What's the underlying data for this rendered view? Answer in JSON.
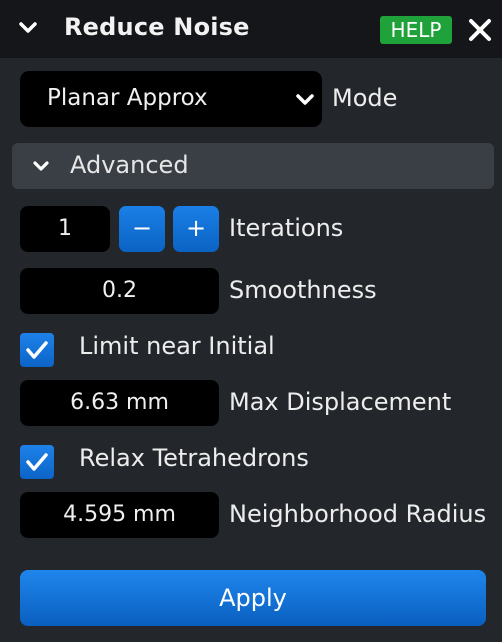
{
  "header": {
    "title": "Reduce Noise",
    "help_label": "HELP",
    "collapse_icon": "chevron-down-icon",
    "close_icon": "close-icon",
    "help_color": "#1fa23a"
  },
  "mode": {
    "selected": "Planar Approx",
    "label": "Mode"
  },
  "advanced": {
    "label": "Advanced",
    "expanded": true
  },
  "iterations": {
    "value": "1",
    "minus_label": "−",
    "plus_label": "+",
    "label": "Iterations"
  },
  "smoothness": {
    "value": "0.2",
    "label": "Smoothness"
  },
  "limit_near_initial": {
    "checked": true,
    "label": "Limit near Initial"
  },
  "max_displacement": {
    "value": "6.63 mm",
    "label": "Max Displacement"
  },
  "relax_tetrahedrons": {
    "checked": true,
    "label": "Relax Tetrahedrons"
  },
  "neighborhood_radius": {
    "value": "4.595 mm",
    "label": "Neighborhood Radius"
  },
  "apply": {
    "label": "Apply"
  },
  "colors": {
    "accent": "#0f6fd6",
    "panel_bg": "#23272b",
    "header_bg": "#141619"
  }
}
